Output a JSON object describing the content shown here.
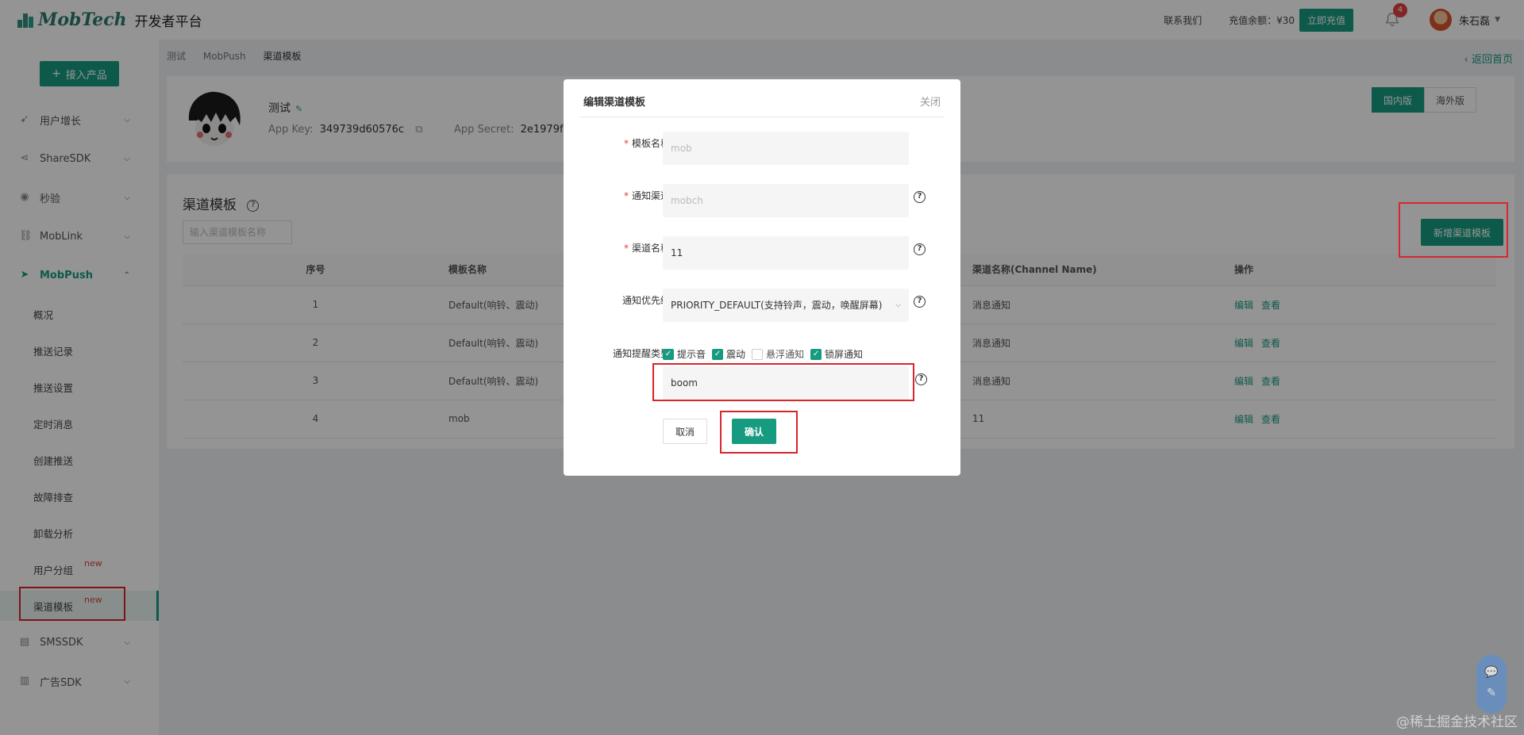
{
  "topbar": {
    "logo_text": "MobTech",
    "logo_sub": "开发者平台",
    "contact": "联系我们",
    "balance": "充值余额：¥30",
    "recharge": "立即充值",
    "notification_count": "4",
    "username": "朱石磊"
  },
  "sidebar": {
    "add_product": "接入产品",
    "groups": [
      {
        "label": "用户增长",
        "icon": "growth-icon"
      },
      {
        "label": "ShareSDK",
        "icon": "share-icon"
      },
      {
        "label": "秒验",
        "icon": "verify-icon"
      },
      {
        "label": "MobLink",
        "icon": "link-icon"
      },
      {
        "label": "MobPush",
        "icon": "push-icon"
      },
      {
        "label": "SMSSDK",
        "icon": "sms-icon"
      },
      {
        "label": "广告SDK",
        "icon": "ad-icon"
      }
    ],
    "sub_items": [
      {
        "label": "概况"
      },
      {
        "label": "推送记录"
      },
      {
        "label": "推送设置"
      },
      {
        "label": "定时消息"
      },
      {
        "label": "创建推送"
      },
      {
        "label": "故障排查"
      },
      {
        "label": "卸载分析"
      },
      {
        "label": "用户分组",
        "tag": "new"
      },
      {
        "label": "渠道模板",
        "tag": "new"
      }
    ]
  },
  "breadcrumb": [
    "测试",
    "MobPush",
    "渠道模板"
  ],
  "back_home": "返回首页",
  "app": {
    "name": "测试",
    "key_label": "App Key:",
    "key_value": "349739d60576c",
    "secret_label": "App Secret:",
    "secret_value": "2e1979f"
  },
  "region_tabs": [
    "国内版",
    "海外版"
  ],
  "content": {
    "title": "渠道模板",
    "filter_placeholder": "输入渠道模板名称",
    "add_button": "新增渠道模板",
    "columns": [
      "序号",
      "模板名称",
      "渠道名称(Channel Name)",
      "操作"
    ],
    "rows": [
      {
        "idx": "1",
        "name": "Default(响铃、震动)",
        "channel": "消息通知"
      },
      {
        "idx": "2",
        "name": "Default(响铃、震动)",
        "channel": "消息通知"
      },
      {
        "idx": "3",
        "name": "Default(响铃、震动)",
        "channel": "消息通知"
      },
      {
        "idx": "4",
        "name": "mob",
        "channel": "11"
      }
    ],
    "op_edit": "编辑",
    "op_view": "查看"
  },
  "modal": {
    "title": "编辑渠道模板",
    "close": "关闭",
    "template_name_label": "模板名称:",
    "template_name_value": "mob",
    "notify_channel_label": "通知渠道:",
    "notify_channel_value": "mobch",
    "channel_name_label": "渠道名称:",
    "channel_name_value": "11",
    "priority_label": "通知优先级:",
    "priority_value": "PRIORITY_DEFAULT(支持铃声，震动，唤醒屏幕)",
    "alert_type_label": "通知提醒类型:",
    "checks": [
      {
        "label": "提示音",
        "checked": true
      },
      {
        "label": "震动",
        "checked": true
      },
      {
        "label": "悬浮通知",
        "checked": false
      },
      {
        "label": "锁屏通知",
        "checked": true
      }
    ],
    "sound_value": "boom",
    "cancel": "取消",
    "confirm": "确认"
  },
  "watermark": "@稀土掘金技术社区",
  "colors": {
    "accent": "#179b80",
    "highlight": "#d9252b",
    "badge": "#e0403f"
  }
}
